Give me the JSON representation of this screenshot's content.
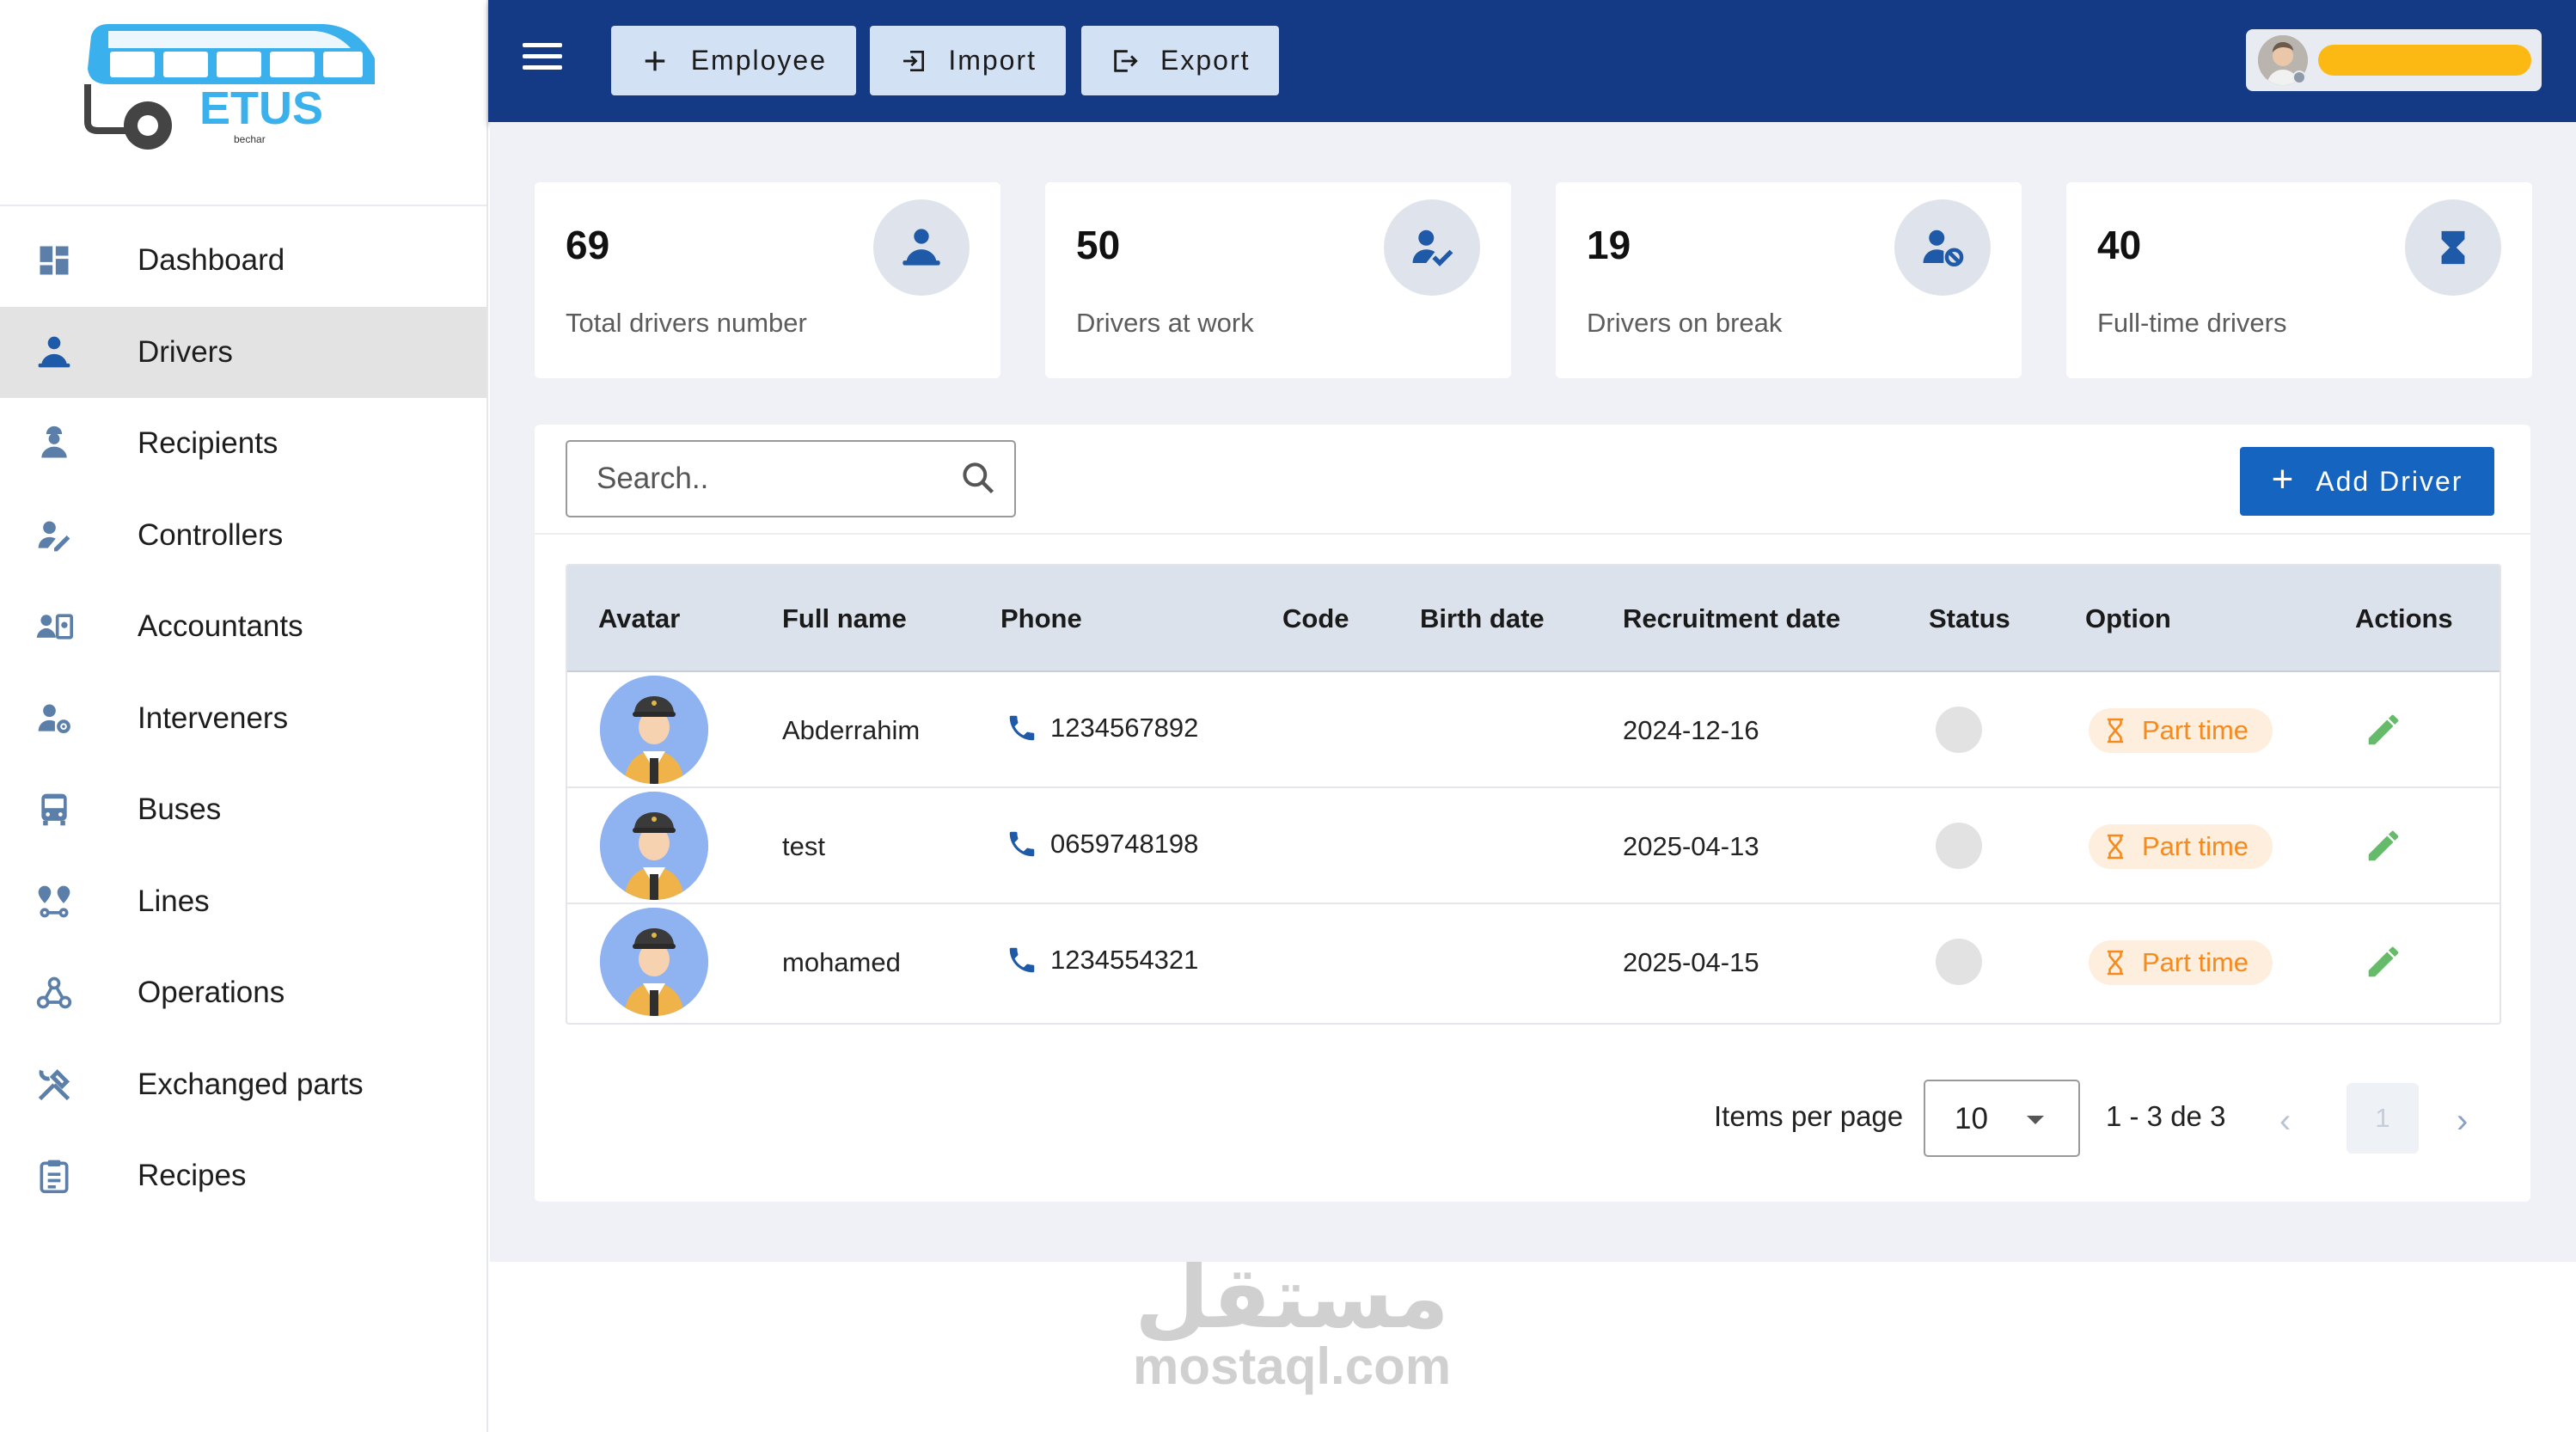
{
  "brand": {
    "name": "ETUS",
    "sub": "bechar"
  },
  "sidebar": {
    "items": [
      {
        "label": "Dashboard",
        "icon": "dashboard-icon"
      },
      {
        "label": "Drivers",
        "icon": "driver-icon",
        "active": true
      },
      {
        "label": "Recipients",
        "icon": "worker-icon"
      },
      {
        "label": "Controllers",
        "icon": "user-edit-icon"
      },
      {
        "label": "Accountants",
        "icon": "accountant-icon"
      },
      {
        "label": "Interveners",
        "icon": "user-gear-icon"
      },
      {
        "label": "Buses",
        "icon": "bus-icon"
      },
      {
        "label": "Lines",
        "icon": "route-icon"
      },
      {
        "label": "Operations",
        "icon": "operations-icon"
      },
      {
        "label": "Exchanged parts",
        "icon": "tools-icon"
      },
      {
        "label": "Recipes",
        "icon": "clipboard-icon"
      }
    ]
  },
  "topbar": {
    "employee_label": "Employee",
    "import_label": "Import",
    "export_label": "Export"
  },
  "stats": [
    {
      "value": "69",
      "label": "Total drivers number",
      "icon": "driver-icon"
    },
    {
      "value": "50",
      "label": "Drivers at work",
      "icon": "user-check-icon"
    },
    {
      "value": "19",
      "label": "Drivers on break",
      "icon": "user-blocked-icon"
    },
    {
      "value": "40",
      "label": "Full-time drivers",
      "icon": "hourglass-icon"
    }
  ],
  "search": {
    "placeholder": "Search.."
  },
  "add_driver_label": "Add Driver",
  "table": {
    "headers": {
      "avatar": "Avatar",
      "full_name": "Full name",
      "phone": "Phone",
      "code": "Code",
      "birth_date": "Birth date",
      "recruitment_date": "Recruitment date",
      "status": "Status",
      "option": "Option",
      "actions": "Actions"
    },
    "rows": [
      {
        "full_name": "Abderrahim",
        "phone": "1234567892",
        "code": "",
        "birth_date": "",
        "recruitment_date": "2024-12-16",
        "option": "Part time"
      },
      {
        "full_name": "test",
        "phone": "0659748198",
        "code": "",
        "birth_date": "",
        "recruitment_date": "2025-04-13",
        "option": "Part time"
      },
      {
        "full_name": "mohamed",
        "phone": "1234554321",
        "code": "",
        "birth_date": "",
        "recruitment_date": "2025-04-15",
        "option": "Part time"
      }
    ]
  },
  "pagination": {
    "items_per_page_label": "Items per page",
    "items_per_page": "10",
    "range": "1 - 3 de 3",
    "current_page": "1"
  },
  "watermark": {
    "arabic": "مستقل",
    "latin": "mostaql.com"
  },
  "colors": {
    "topbar": "#153a85",
    "primary": "#1565c0",
    "badge_text": "#f58a1f",
    "edit": "#66bb6a"
  }
}
